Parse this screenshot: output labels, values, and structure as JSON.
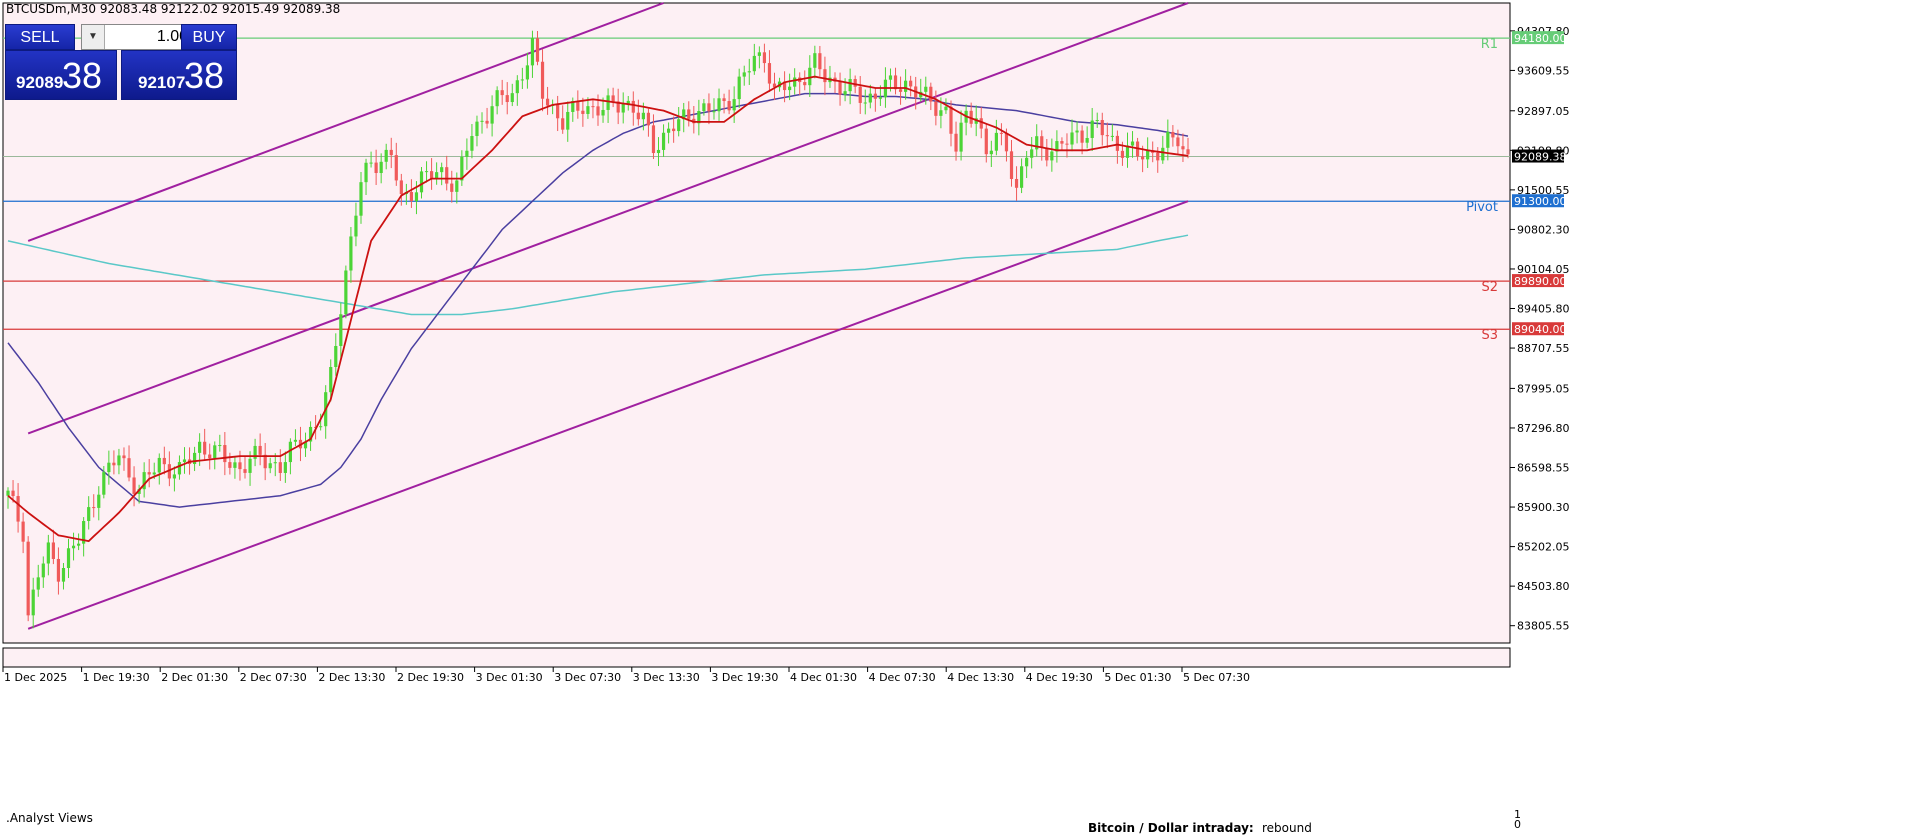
{
  "header": {
    "symbol_line": "BTCUSDm,M30  92083.48 92122.02 92015.49 92089.38"
  },
  "trade_panel": {
    "sell_label": "SELL",
    "buy_label": "BUY",
    "quantity": "1.00",
    "sell_small": "92089",
    "sell_big": "38",
    "buy_small": "92107",
    "buy_big": "38"
  },
  "indicator_panel": {
    "name": ".Analyst Views",
    "scale_top": "1",
    "scale_bottom": "0",
    "caption_bold": "Bitcoin / Dollar intraday:",
    "caption_value": "rebound"
  },
  "colors": {
    "background": "#fdf0f4",
    "bull": "#4cd436",
    "bear": "#f05a5a",
    "channel": "#a020a0",
    "ma_fast": "#cc1111",
    "ma_mid": "#4a3fa0",
    "ma_slow": "#5ac8c8",
    "pivot": "#1e6fd0",
    "r1": "#66cc77",
    "support": "#d83a3a"
  },
  "chart_data": {
    "type": "candlestick",
    "ylim": [
      83500,
      94800
    ],
    "y_ticks": [
      "94307.80",
      "93609.55",
      "92897.05",
      "92198.80",
      "91500.55",
      "90802.30",
      "90104.05",
      "89405.80",
      "88707.55",
      "87995.05",
      "87296.80",
      "86598.55",
      "85900.30",
      "85202.05",
      "84503.80",
      "83805.55"
    ],
    "x_ticks": [
      "1 Dec 2025",
      "1 Dec 19:30",
      "2 Dec 01:30",
      "2 Dec 07:30",
      "2 Dec 13:30",
      "2 Dec 19:30",
      "3 Dec 01:30",
      "3 Dec 07:30",
      "3 Dec 13:30",
      "3 Dec 19:30",
      "4 Dec 01:30",
      "4 Dec 07:30",
      "4 Dec 13:30",
      "4 Dec 19:30",
      "5 Dec 01:30",
      "5 Dec 07:30"
    ],
    "current_price": {
      "value": 92089.38,
      "label": "92089.38"
    },
    "levels": [
      {
        "name": "R1",
        "value": 94180,
        "label": "94180.00",
        "color": "#66cc77"
      },
      {
        "name": "Pivot",
        "value": 91300,
        "label": "91300.00",
        "color": "#1e6fd0"
      },
      {
        "name": "S2",
        "value": 89890,
        "label": "89890.00",
        "color": "#d83a3a"
      },
      {
        "name": "S3",
        "value": 89040,
        "label": "89040.00",
        "color": "#d83a3a"
      }
    ],
    "ohlc_anchors": [
      [
        0,
        86100
      ],
      [
        3,
        85500
      ],
      [
        4,
        84000
      ],
      [
        6,
        84700
      ],
      [
        8,
        85100
      ],
      [
        10,
        84800
      ],
      [
        14,
        85300
      ],
      [
        18,
        86300
      ],
      [
        22,
        86800
      ],
      [
        26,
        86200
      ],
      [
        30,
        86700
      ],
      [
        34,
        86500
      ],
      [
        38,
        87000
      ],
      [
        42,
        86800
      ],
      [
        46,
        86600
      ],
      [
        50,
        86800
      ],
      [
        54,
        86600
      ],
      [
        58,
        87100
      ],
      [
        62,
        87400
      ],
      [
        64,
        88200
      ],
      [
        66,
        89500
      ],
      [
        68,
        90600
      ],
      [
        70,
        91600
      ],
      [
        72,
        92000
      ],
      [
        76,
        92100
      ],
      [
        78,
        91300
      ],
      [
        82,
        91700
      ],
      [
        86,
        91800
      ],
      [
        89,
        91600
      ],
      [
        92,
        92500
      ],
      [
        96,
        93000
      ],
      [
        100,
        93200
      ],
      [
        104,
        94000
      ],
      [
        106,
        93200
      ],
      [
        110,
        92700
      ],
      [
        114,
        93000
      ],
      [
        118,
        92900
      ],
      [
        122,
        93100
      ],
      [
        126,
        92700
      ],
      [
        128,
        92300
      ],
      [
        132,
        92600
      ],
      [
        136,
        92900
      ],
      [
        140,
        92900
      ],
      [
        144,
        93200
      ],
      [
        148,
        93800
      ],
      [
        150,
        93900
      ],
      [
        152,
        93200
      ],
      [
        156,
        93400
      ],
      [
        160,
        93700
      ],
      [
        162,
        93500
      ],
      [
        166,
        93300
      ],
      [
        170,
        93100
      ],
      [
        174,
        93300
      ],
      [
        178,
        93400
      ],
      [
        182,
        93100
      ],
      [
        186,
        92900
      ],
      [
        188,
        92200
      ],
      [
        190,
        92800
      ],
      [
        192,
        92900
      ],
      [
        194,
        92100
      ],
      [
        196,
        92400
      ],
      [
        198,
        92300
      ],
      [
        200,
        91500
      ],
      [
        202,
        92100
      ],
      [
        204,
        92300
      ],
      [
        208,
        92200
      ],
      [
        212,
        92500
      ],
      [
        216,
        92600
      ],
      [
        220,
        92300
      ],
      [
        224,
        92100
      ],
      [
        228,
        92200
      ],
      [
        232,
        92400
      ],
      [
        234,
        92089
      ]
    ],
    "channel_lines": [
      {
        "x0": 4,
        "y0": 90600,
        "x1": 130,
        "y1": 94800
      },
      {
        "x0": 4,
        "y0": 87200,
        "x1": 234,
        "y1": 94800
      },
      {
        "x0": 4,
        "y0": 83750,
        "x1": 234,
        "y1": 91300
      }
    ],
    "ma_fast_anchors": [
      [
        0,
        86100
      ],
      [
        4,
        85800
      ],
      [
        10,
        85400
      ],
      [
        16,
        85300
      ],
      [
        22,
        85800
      ],
      [
        28,
        86400
      ],
      [
        36,
        86700
      ],
      [
        46,
        86800
      ],
      [
        54,
        86800
      ],
      [
        60,
        87100
      ],
      [
        64,
        87800
      ],
      [
        68,
        89200
      ],
      [
        72,
        90600
      ],
      [
        78,
        91400
      ],
      [
        84,
        91700
      ],
      [
        90,
        91700
      ],
      [
        96,
        92200
      ],
      [
        102,
        92800
      ],
      [
        108,
        93000
      ],
      [
        116,
        93100
      ],
      [
        124,
        93000
      ],
      [
        130,
        92900
      ],
      [
        136,
        92700
      ],
      [
        142,
        92700
      ],
      [
        148,
        93100
      ],
      [
        154,
        93400
      ],
      [
        160,
        93500
      ],
      [
        166,
        93400
      ],
      [
        172,
        93300
      ],
      [
        178,
        93300
      ],
      [
        184,
        93100
      ],
      [
        190,
        92800
      ],
      [
        196,
        92600
      ],
      [
        202,
        92300
      ],
      [
        208,
        92200
      ],
      [
        214,
        92200
      ],
      [
        220,
        92300
      ],
      [
        226,
        92200
      ],
      [
        234,
        92100
      ]
    ],
    "ma_mid_anchors": [
      [
        0,
        88800
      ],
      [
        6,
        88100
      ],
      [
        12,
        87300
      ],
      [
        18,
        86600
      ],
      [
        26,
        86000
      ],
      [
        34,
        85900
      ],
      [
        44,
        86000
      ],
      [
        54,
        86100
      ],
      [
        62,
        86300
      ],
      [
        66,
        86600
      ],
      [
        70,
        87100
      ],
      [
        74,
        87800
      ],
      [
        80,
        88700
      ],
      [
        86,
        89400
      ],
      [
        92,
        90100
      ],
      [
        98,
        90800
      ],
      [
        104,
        91300
      ],
      [
        110,
        91800
      ],
      [
        116,
        92200
      ],
      [
        122,
        92500
      ],
      [
        128,
        92700
      ],
      [
        134,
        92800
      ],
      [
        140,
        92900
      ],
      [
        146,
        93000
      ],
      [
        152,
        93100
      ],
      [
        158,
        93200
      ],
      [
        164,
        93200
      ],
      [
        170,
        93150
      ],
      [
        176,
        93150
      ],
      [
        182,
        93100
      ],
      [
        188,
        93000
      ],
      [
        194,
        92950
      ],
      [
        200,
        92900
      ],
      [
        206,
        92800
      ],
      [
        212,
        92700
      ],
      [
        220,
        92650
      ],
      [
        228,
        92550
      ],
      [
        234,
        92450
      ]
    ],
    "ma_slow_anchors": [
      [
        0,
        90600
      ],
      [
        20,
        90200
      ],
      [
        40,
        89900
      ],
      [
        60,
        89600
      ],
      [
        70,
        89450
      ],
      [
        80,
        89300
      ],
      [
        90,
        89300
      ],
      [
        100,
        89400
      ],
      [
        110,
        89550
      ],
      [
        120,
        89700
      ],
      [
        130,
        89800
      ],
      [
        140,
        89900
      ],
      [
        150,
        90000
      ],
      [
        160,
        90050
      ],
      [
        170,
        90100
      ],
      [
        180,
        90200
      ],
      [
        190,
        90300
      ],
      [
        200,
        90350
      ],
      [
        210,
        90400
      ],
      [
        220,
        90450
      ],
      [
        228,
        90600
      ],
      [
        234,
        90700
      ]
    ]
  }
}
